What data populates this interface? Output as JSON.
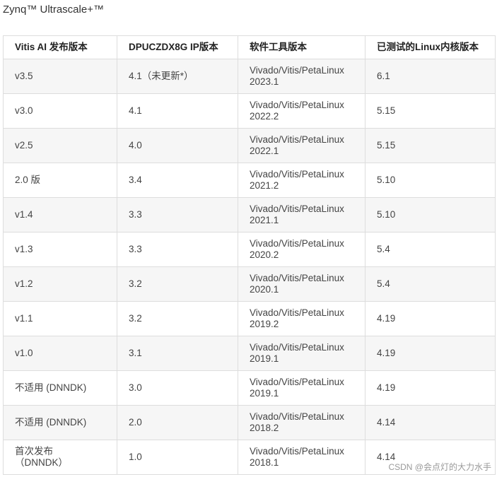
{
  "page": {
    "title": "Zynq™ Ultrascale+™"
  },
  "table": {
    "headers": [
      "Vitis AI 发布版本",
      "DPUCZDX8G IP版本",
      "软件工具版本",
      "已测试的Linux内核版本"
    ],
    "rows": [
      {
        "release": [
          "v3.5"
        ],
        "ip": "4.1（未更新*）",
        "tools": [
          "Vivado/Vitis/PetaLinux",
          "2023.1"
        ],
        "kernel": "6.1"
      },
      {
        "release": [
          "v3.0"
        ],
        "ip": "4.1",
        "tools": [
          "Vivado/Vitis/PetaLinux",
          "2022.2"
        ],
        "kernel": "5.15"
      },
      {
        "release": [
          "v2.5"
        ],
        "ip": "4.0",
        "tools": [
          "Vivado/Vitis/PetaLinux",
          "2022.1"
        ],
        "kernel": "5.15"
      },
      {
        "release": [
          "2.0 版"
        ],
        "ip": "3.4",
        "tools": [
          "Vivado/Vitis/PetaLinux",
          "2021.2"
        ],
        "kernel": "5.10"
      },
      {
        "release": [
          "v1.4"
        ],
        "ip": "3.3",
        "tools": [
          "Vivado/Vitis/PetaLinux",
          "2021.1"
        ],
        "kernel": "5.10"
      },
      {
        "release": [
          "v1.3"
        ],
        "ip": "3.3",
        "tools": [
          "Vivado/Vitis/PetaLinux",
          "2020.2"
        ],
        "kernel": "5.4"
      },
      {
        "release": [
          "v1.2"
        ],
        "ip": "3.2",
        "tools": [
          "Vivado/Vitis/PetaLinux",
          "2020.1"
        ],
        "kernel": "5.4"
      },
      {
        "release": [
          "v1.1"
        ],
        "ip": "3.2",
        "tools": [
          "Vivado/Vitis/PetaLinux",
          "2019.2"
        ],
        "kernel": "4.19"
      },
      {
        "release": [
          "v1.0"
        ],
        "ip": "3.1",
        "tools": [
          "Vivado/Vitis/PetaLinux",
          "2019.1"
        ],
        "kernel": "4.19"
      },
      {
        "release": [
          "不适用 (DNNDK)"
        ],
        "ip": "3.0",
        "tools": [
          "Vivado/Vitis/PetaLinux",
          "2019.1"
        ],
        "kernel": "4.19"
      },
      {
        "release": [
          "不适用 (DNNDK)"
        ],
        "ip": "2.0",
        "tools": [
          "Vivado/Vitis/PetaLinux",
          "2018.2"
        ],
        "kernel": "4.14"
      },
      {
        "release": [
          "首次发布",
          "（DNNDK）"
        ],
        "ip": "1.0",
        "tools": [
          "Vivado/Vitis/PetaLinux",
          "2018.1"
        ],
        "kernel": "4.14"
      }
    ]
  },
  "watermark": {
    "text": "CSDN @会点灯的大力水手"
  }
}
